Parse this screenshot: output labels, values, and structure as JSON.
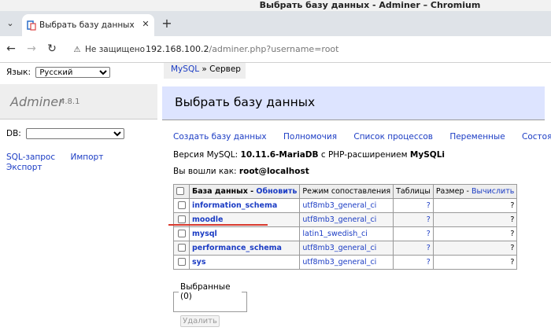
{
  "window": {
    "title": "Выбрать базу данных - Adminer – Chromium"
  },
  "tab": {
    "title": "Выбрать базу данных - Adminer"
  },
  "address": {
    "security_label": "Не защищено",
    "url_host": "192.168.100.2",
    "url_path": "/adminer.php?username=root"
  },
  "sidebar": {
    "lang_label": "Язык:",
    "lang_value": "Русский",
    "brand": "Adminer",
    "version": "4.8.1",
    "db_label": "DB:",
    "links": [
      "SQL-запрос",
      "Импорт",
      "Экспорт"
    ]
  },
  "breadcrumb": {
    "driver": "MySQL",
    "sep": " » ",
    "current": "Сервер"
  },
  "main": {
    "heading": "Выбрать базу данных",
    "links": [
      "Создать базу данных",
      "Полномочия",
      "Список процессов",
      "Переменные",
      "Состояние"
    ],
    "version_prefix": "Версия MySQL: ",
    "version_value": "10.11.6-MariaDB",
    "version_mid": " с PHP-расширением ",
    "version_ext": "MySQLi",
    "login_prefix": "Вы вошли как: ",
    "login_value": "root@localhost"
  },
  "table": {
    "headers": {
      "database": "База данных",
      "sep": " - ",
      "refresh": "Обновить",
      "collation": "Режим сопоставления",
      "tables": "Таблицы",
      "size": "Размер",
      "compute": "Вычислить"
    },
    "rows": [
      {
        "name": "information_schema",
        "collation": "utf8mb3_general_ci",
        "tables": "?",
        "size": "?"
      },
      {
        "name": "moodle",
        "collation": "utf8mb3_general_ci",
        "tables": "?",
        "size": "?"
      },
      {
        "name": "mysql",
        "collation": "latin1_swedish_ci",
        "tables": "?",
        "size": "?"
      },
      {
        "name": "performance_schema",
        "collation": "utf8mb3_general_ci",
        "tables": "?",
        "size": "?"
      },
      {
        "name": "sys",
        "collation": "utf8mb3_general_ci",
        "tables": "?",
        "size": "?"
      }
    ]
  },
  "selected": {
    "legend": "Выбранные (0)",
    "delete_label": "Удалить"
  },
  "colors": {
    "link": "#1b3cc4",
    "header_bg": "#dde4ff",
    "annotation": "#d83a2e"
  }
}
